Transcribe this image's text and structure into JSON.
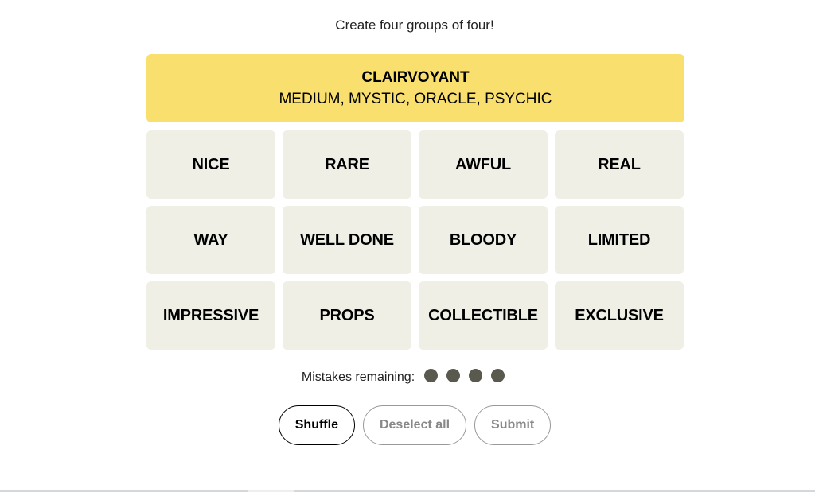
{
  "subtitle": "Create four groups of four!",
  "solved_groups": [
    {
      "category": "CLAIRVOYANT",
      "words": "MEDIUM, MYSTIC, ORACLE, PSYCHIC",
      "color": "#f9df6d"
    }
  ],
  "tiles": [
    "NICE",
    "RARE",
    "AWFUL",
    "REAL",
    "WAY",
    "WELL DONE",
    "BLOODY",
    "LIMITED",
    "IMPRESSIVE",
    "PROPS",
    "COLLECTIBLE",
    "EXCLUSIVE"
  ],
  "mistakes": {
    "label": "Mistakes remaining:",
    "remaining": 4
  },
  "buttons": {
    "shuffle": "Shuffle",
    "deselect": "Deselect all",
    "submit": "Submit"
  }
}
